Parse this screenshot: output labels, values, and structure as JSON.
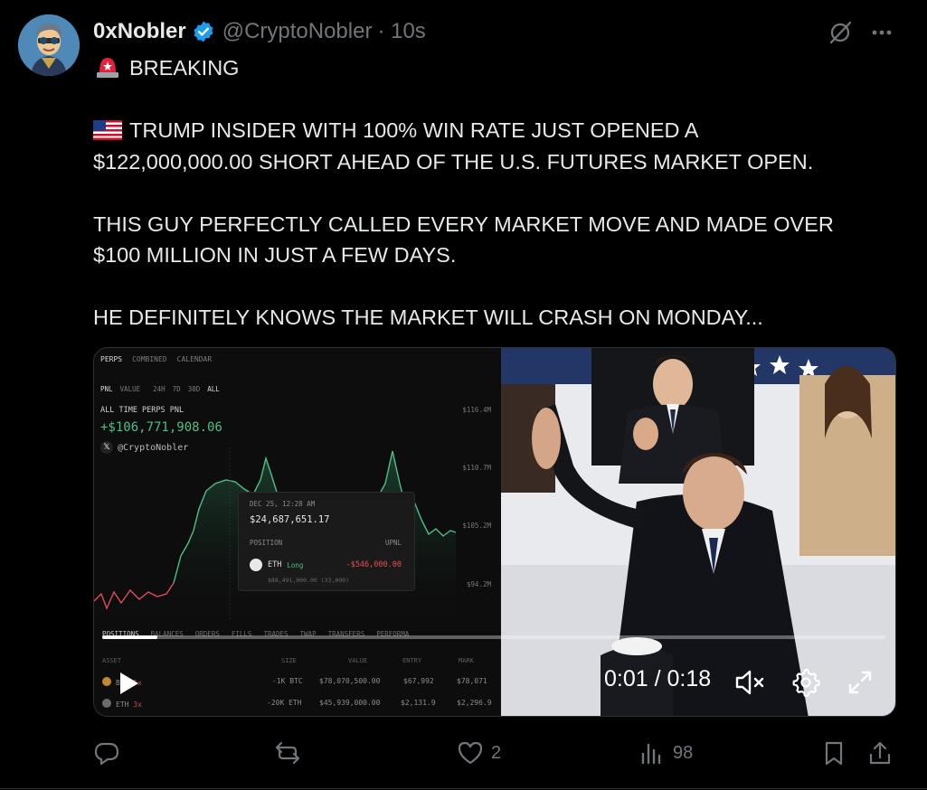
{
  "author": {
    "name": "0xNobler",
    "handle": "@CryptoNobler",
    "time": "· 10s",
    "verified": true,
    "avatar_icon": "avatar"
  },
  "tweet": {
    "line1": "BREAKING",
    "para1": "TRUMP INSIDER WITH 100% WIN RATE JUST OPENED A\n$122,000,000.00 SHORT AHEAD OF THE U.S. FUTURES MARKET OPEN.",
    "para2": "THIS GUY PERFECTLY CALLED EVERY MARKET MOVE AND MADE OVER\n$100 MILLION IN JUST A FEW DAYS.",
    "para3": "HE DEFINITELY KNOWS THE MARKET WILL CRASH ON MONDAY..."
  },
  "video": {
    "tabs": [
      "PERPS",
      "COMBINED",
      "CALENDAR"
    ],
    "subtabs": [
      "PNL",
      "VALUE",
      "24H",
      "7D",
      "30D",
      "ALL"
    ],
    "pnl_label": "ALL TIME PERPS PNL",
    "pnl_value": "+$106,771,908.06",
    "watermark": "@CryptoNobler",
    "axis": [
      "$116.4M",
      "$110.7M",
      "$105.2M",
      "$94.2M"
    ],
    "tooltip": {
      "date": "DEC 25, 12:28 AM",
      "value": "$24,687,651.17",
      "position_label": "POSITION",
      "upnl_label": "UPNL",
      "asset": "ETH",
      "side": "Long",
      "loss": "-$546,000.00",
      "sub": "$88,491,000.00 (33,000)"
    },
    "bottom_tabs": [
      "POSITIONS",
      "BALANCES",
      "ORDERS",
      "FILLS",
      "TRADES",
      "TWAP",
      "TRANSFERS",
      "PERFORMA"
    ],
    "table_headers": [
      "ASSET",
      "SIZE",
      "VALUE",
      "ENTRY",
      "MARK"
    ],
    "rows": [
      {
        "asset": "BTC",
        "lev": "5x",
        "size": "-1K BTC",
        "value": "$78,070,500.00",
        "entry": "$67,992",
        "mark": "$78,071"
      },
      {
        "asset": "ETH",
        "lev": "3x",
        "size": "-20K ETH",
        "value": "$45,939,000.00",
        "entry": "$2,131.9",
        "mark": "$2,296.9"
      }
    ],
    "time_display": "0:01 / 0:18",
    "progress": 0.07
  },
  "actions": {
    "reply_count": "",
    "repost_count": "",
    "like_count": "2",
    "views_count": "98"
  },
  "colors": {
    "background": "#000000",
    "text": "#e7e9ea",
    "muted": "#71767b",
    "verified": "#1d9bf0",
    "pnl_green": "#4fbf86",
    "loss_red": "#e05252"
  }
}
